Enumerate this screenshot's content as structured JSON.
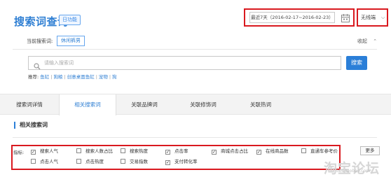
{
  "header": {
    "title": "搜索词查询",
    "badge": "日功能",
    "date_range": "最近7天（2016-02-17~2016-02-23）",
    "device": "无线端",
    "calendar_icon": "calendar-icon",
    "chevron_icon": "chevron-down-icon"
  },
  "query": {
    "current_label": "当前搜索词:",
    "current_term": "休闲裤男",
    "collapse_label": "收起",
    "search_placeholder": "请输入搜索词",
    "search_button": "搜索",
    "recommend_label": "推荐:",
    "recommend_items": [
      "鱼缸",
      "狗粮",
      "创意桌面鱼缸",
      "宠物",
      "狗"
    ]
  },
  "tabs": [
    {
      "label": "搜索词详情",
      "active": false
    },
    {
      "label": "相关搜索词",
      "active": true
    },
    {
      "label": "关联品牌词",
      "active": false
    },
    {
      "label": "关联修饰词",
      "active": false
    },
    {
      "label": "关联热词",
      "active": false
    }
  ],
  "section": {
    "title": "相关搜索词"
  },
  "indicators": {
    "label": "指标:",
    "more_button": "更多",
    "row1": [
      {
        "label": "搜索人气",
        "checked": true
      },
      {
        "label": "搜索人数占比",
        "checked": false
      },
      {
        "label": "搜索热度",
        "checked": false
      },
      {
        "label": "点击率",
        "checked": true
      },
      {
        "label": "商城点击占比",
        "checked": true
      },
      {
        "label": "在线商品数",
        "checked": true
      },
      {
        "label": "直通车参考价",
        "checked": false
      }
    ],
    "row2": [
      {
        "label": "点击人气",
        "checked": false
      },
      {
        "label": "点击热度",
        "checked": false
      },
      {
        "label": "交易指数",
        "checked": false
      },
      {
        "label": "支付转化率",
        "checked": true
      }
    ]
  },
  "watermark": {
    "text": "淘宝论坛",
    "url": "bbs.taobao.com"
  },
  "colors": {
    "accent": "#2b7fd8",
    "highlight_border": "#d9191f",
    "tab_bg": "#f3f3f3"
  }
}
